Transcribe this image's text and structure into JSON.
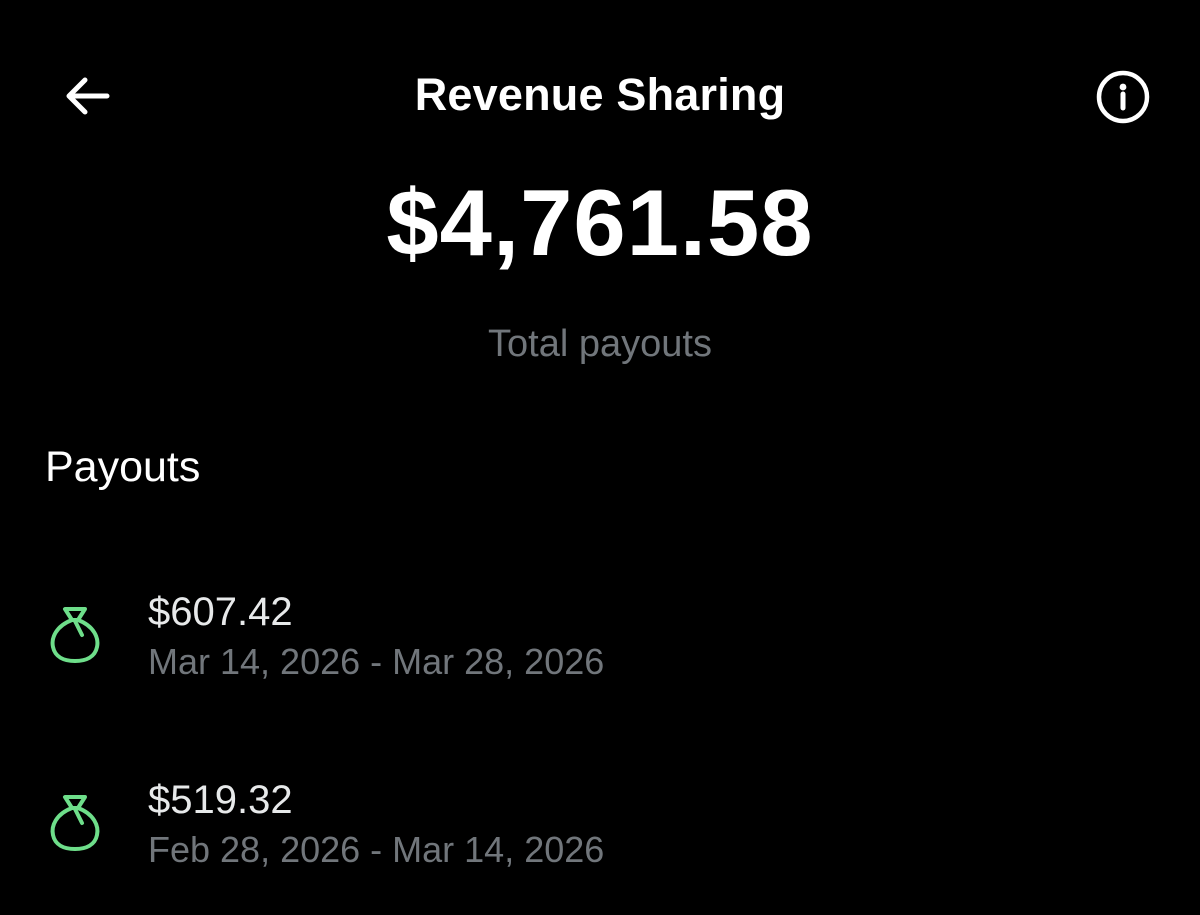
{
  "header": {
    "title": "Revenue Sharing",
    "back_icon": "arrow-left-icon",
    "info_icon": "info-icon"
  },
  "summary": {
    "total_amount": "$4,761.58",
    "total_label": "Total payouts"
  },
  "payouts": {
    "section_title": "Payouts",
    "icon": "money-bag-icon",
    "icon_color": "#6ede8a",
    "items": [
      {
        "amount": "$607.42",
        "range": "Mar 14, 2026 - Mar 28, 2026"
      },
      {
        "amount": "$519.32",
        "range": "Feb 28, 2026 - Mar 14, 2026"
      }
    ]
  },
  "colors": {
    "background": "#000000",
    "primary_text": "#ffffff",
    "secondary_text": "#71767b",
    "accent_green": "#6ede8a"
  }
}
